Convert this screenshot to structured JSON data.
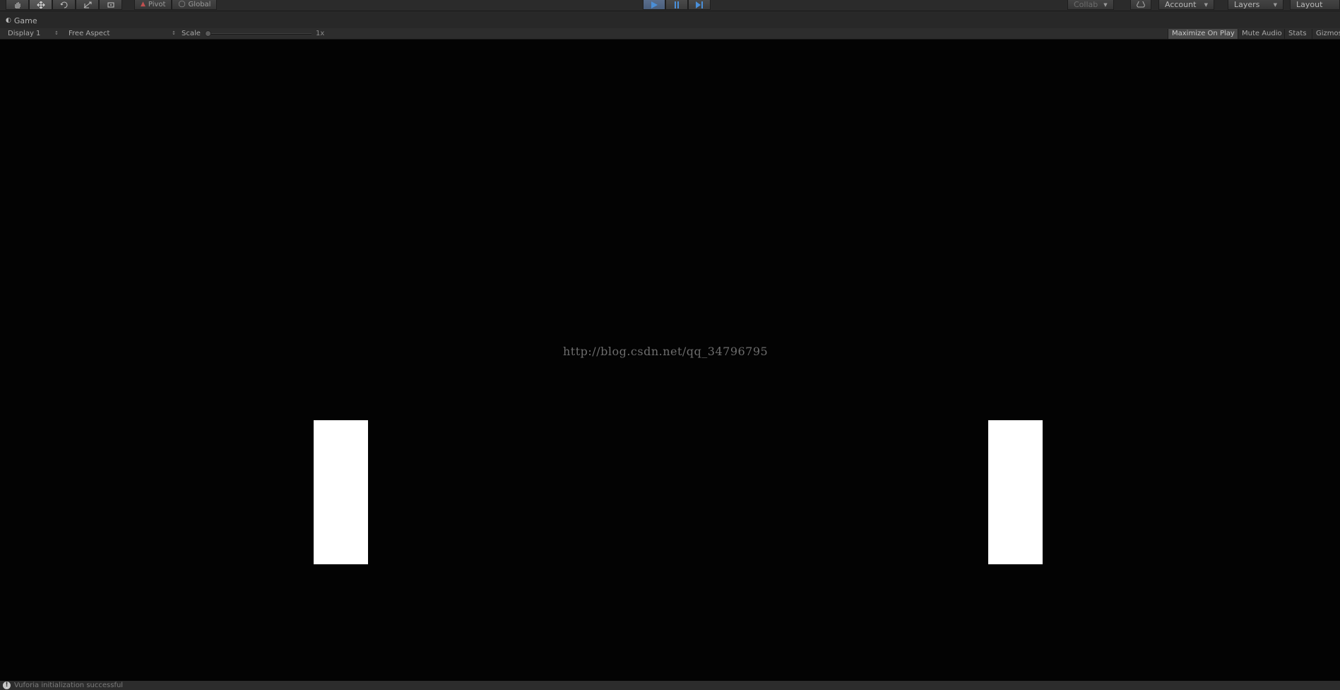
{
  "toolbar": {
    "transform_tools": [
      {
        "name": "hand-tool",
        "icon": "hand-icon"
      },
      {
        "name": "move-tool",
        "icon": "move-arrows-icon"
      },
      {
        "name": "rotate-tool",
        "icon": "rotate-icon"
      },
      {
        "name": "scale-tool",
        "icon": "scale-icon"
      },
      {
        "name": "rect-tool",
        "icon": "rect-transform-icon"
      }
    ],
    "pivot_label": "Pivot",
    "global_label": "Global",
    "play_controls": [
      "play",
      "pause",
      "step"
    ],
    "collab_label": "Collab",
    "account_label": "Account",
    "layers_label": "Layers",
    "layout_label": "Layout"
  },
  "game_tab": {
    "label": "Game",
    "icon": "game-controller-icon"
  },
  "game_options": {
    "display_label": "Display 1",
    "aspect_label": "Free Aspect",
    "scale_label": "Scale",
    "scale_value": "1x",
    "maximize_label": "Maximize On Play",
    "mute_label": "Mute Audio",
    "stats_label": "Stats",
    "gizmos_label": "Gizmos"
  },
  "viewport": {
    "watermark": "http://blog.csdn.net/qq_34796795"
  },
  "status": {
    "message": "Vuforia initialization successful"
  },
  "colors": {
    "editor_dark": "#2b2b2b",
    "viewport": "#030303",
    "play_active": "#4a5e7c",
    "play_icon": "#4a8fd8"
  }
}
